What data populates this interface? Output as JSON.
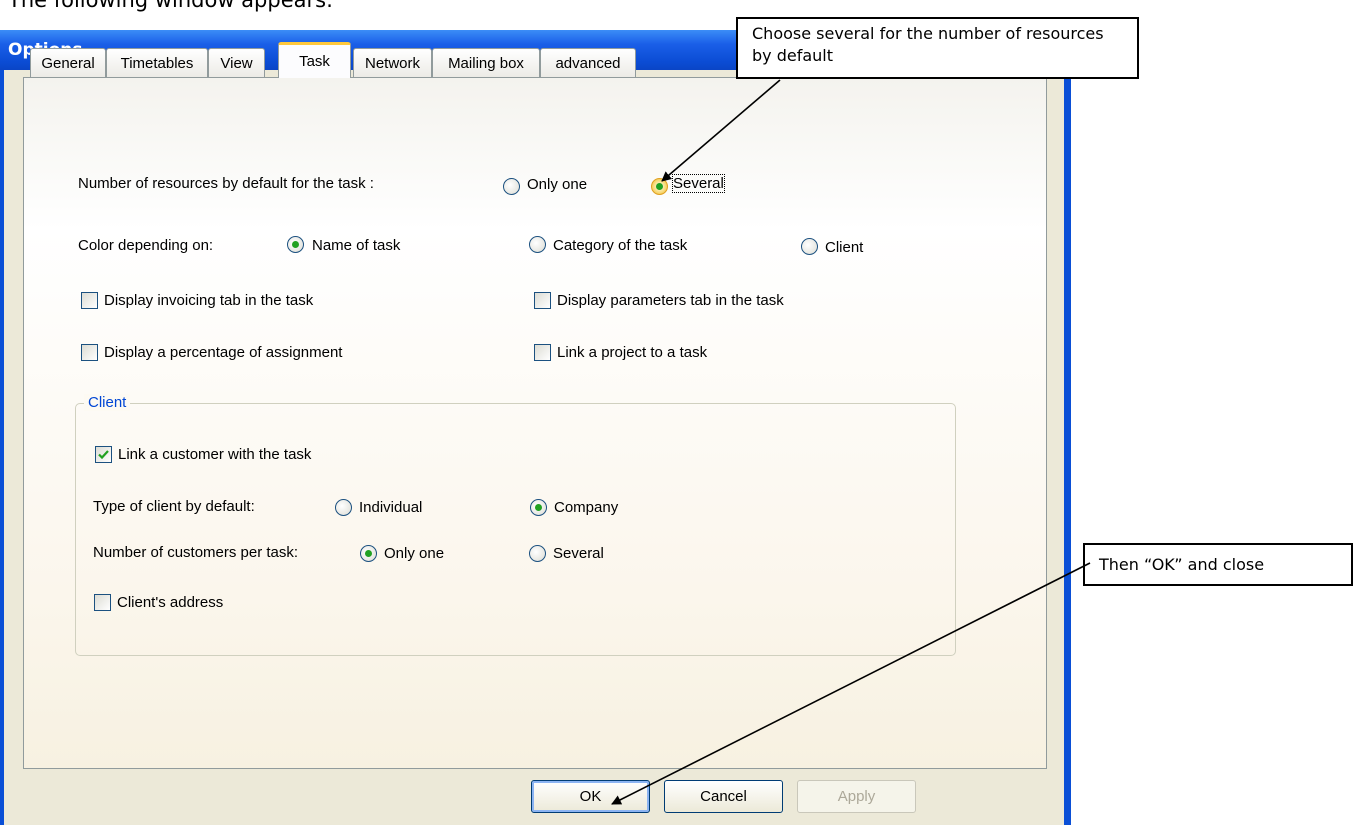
{
  "doc_line": "The following window appears:",
  "window": {
    "title": "Options"
  },
  "tabs": [
    "General",
    "Timetables",
    "View",
    "Task",
    "Network",
    "Mailing box",
    "advanced"
  ],
  "active_tab": "Task",
  "task": {
    "resources_label": "Number of resources by default for the task :",
    "resources_options": [
      "Only one",
      "Several"
    ],
    "resources_selected": "Several",
    "color_label": "Color depending on:",
    "color_options": [
      "Name of task",
      "Category of the task",
      "Client"
    ],
    "color_selected": "Name of task",
    "invoicing_label": "Display invoicing tab in the task",
    "invoicing_checked": false,
    "parameters_label": "Display parameters tab in the task",
    "parameters_checked": false,
    "percentage_label": "Display a percentage of assignment",
    "percentage_checked": false,
    "project_label": "Link a project to a task",
    "project_checked": false
  },
  "client_group": {
    "title": "Client",
    "link_label": "Link a customer with the task",
    "link_checked": true,
    "type_label": "Type of client by default:",
    "type_options": [
      "Individual",
      "Company"
    ],
    "type_selected": "Company",
    "count_label": "Number of customers per task:",
    "count_options": [
      "Only one",
      "Several"
    ],
    "count_selected": "Only one",
    "address_label": "Client's address",
    "address_checked": false
  },
  "buttons": {
    "ok": "OK",
    "cancel": "Cancel",
    "apply": "Apply"
  },
  "callouts": {
    "top": "Choose several for the number of resources by default",
    "right": "Then “OK” and close"
  }
}
